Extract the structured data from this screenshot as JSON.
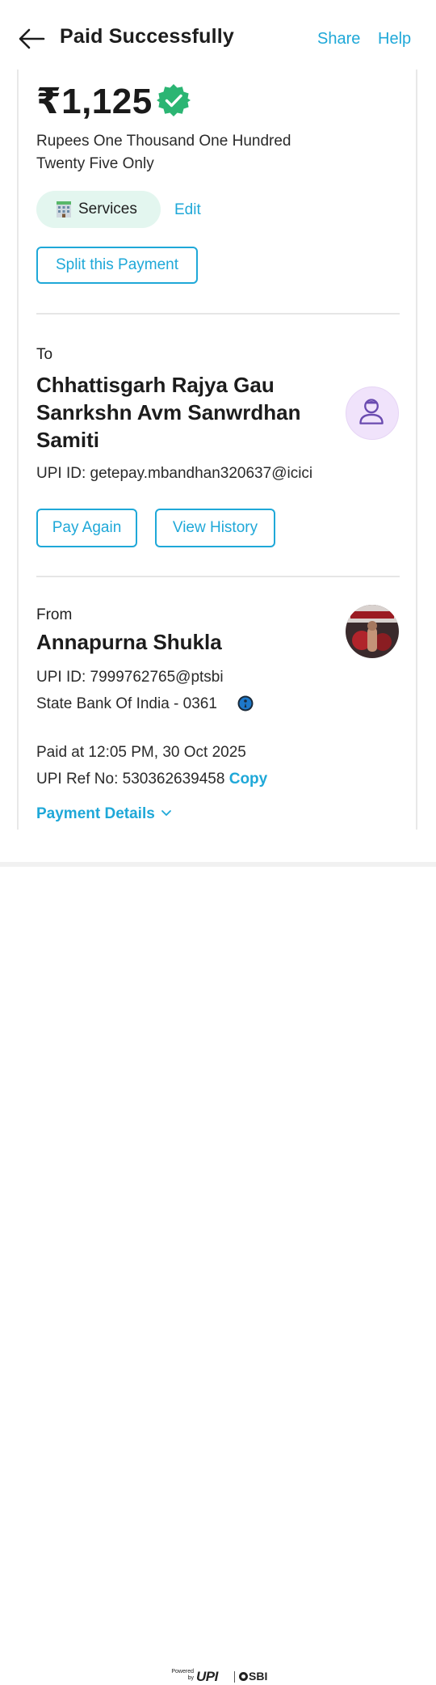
{
  "header": {
    "title": "Paid Successfully",
    "share_label": "Share",
    "help_label": "Help"
  },
  "amount": {
    "value": "₹1,125",
    "in_words": "Rupees One Thousand One Hundred Twenty Five Only"
  },
  "category": {
    "label": "Services",
    "edit_label": "Edit"
  },
  "split_label": "Split this Payment",
  "recipient": {
    "heading": "To",
    "name": "Chhattisgarh Rajya Gau Sanrkshn Avm Sanwrdhan Samiti",
    "upi_id": "UPI ID: getepay.mbandhan320637@icici",
    "pay_again_label": "Pay Again",
    "history_label": "View History"
  },
  "sender": {
    "heading": "From",
    "name": "Annapurna Shukla",
    "upi_id": "UPI ID: 7999762765@ptsbi",
    "bank": "State Bank Of India - 0361"
  },
  "transaction": {
    "paid_at": "Paid at 12:05 PM, 30 Oct 2025",
    "ref_prefix": "UPI Ref No: 530362639458",
    "copy_label": "Copy",
    "details_label": "Payment Details"
  },
  "footer": {
    "powered_by": "Powered by",
    "upi_logo": "UPI",
    "bank_logo": "SBI"
  },
  "colors": {
    "accent": "#1fa8d8",
    "verified_green": "#2bb573",
    "chip_bg": "#e3f6ef",
    "avatar_bg": "#f0e3fb"
  },
  "icons": [
    "back-arrow-icon",
    "verified-badge-icon",
    "bank-building-icon",
    "user-avatar-icon",
    "info-icon",
    "chevron-down-icon"
  ]
}
